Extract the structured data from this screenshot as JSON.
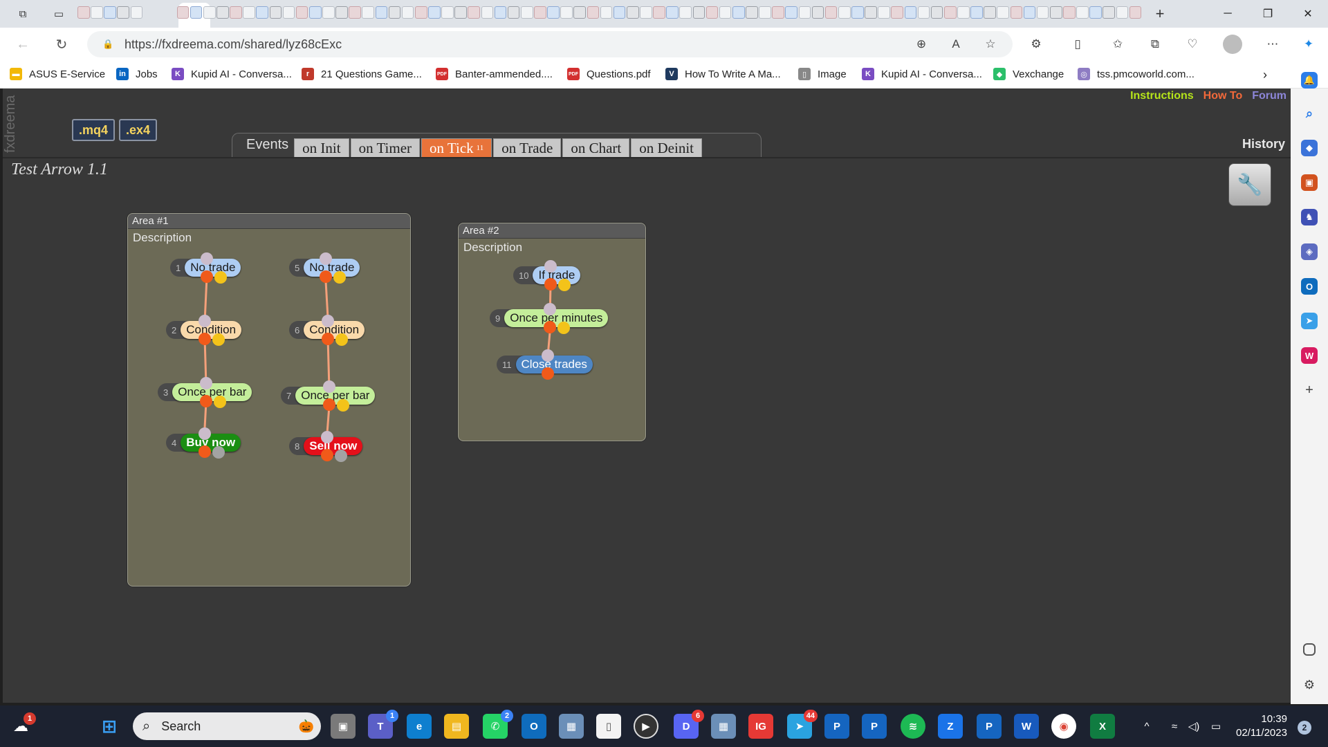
{
  "browser": {
    "url": "https://fxdreema.com/shared/lyz68cExc",
    "bookmarks": [
      {
        "label": "ASUS E-Service",
        "icon": "folder-icon",
        "color": "#f2b807"
      },
      {
        "label": "Jobs",
        "icon": "linkedin-icon",
        "color": "#0a66c2"
      },
      {
        "label": "Kupid AI - Conversa...",
        "icon": "kupid-icon",
        "color": "#7a4cc2"
      },
      {
        "label": "21 Questions Game...",
        "icon": "reddit-icon",
        "color": "#c0392b"
      },
      {
        "label": "Banter-ammended....",
        "icon": "pdf-icon",
        "color": "#d32f2f"
      },
      {
        "label": "Questions.pdf",
        "icon": "pdf-icon",
        "color": "#d32f2f"
      },
      {
        "label": "How To Write A Ma...",
        "icon": "v-icon",
        "color": "#1f3a5f"
      },
      {
        "label": "Image",
        "icon": "file-icon",
        "color": "#888888"
      },
      {
        "label": "Kupid AI - Conversa...",
        "icon": "kupid-icon",
        "color": "#7a4cc2"
      },
      {
        "label": "Vexchange",
        "icon": "vexchange-icon",
        "color": "#2bbf6a"
      },
      {
        "label": "tss.pmcoworld.com...",
        "icon": "globe-icon",
        "color": "#8e7cc3"
      }
    ]
  },
  "app": {
    "side_label": "fxdreema",
    "format_buttons": [
      ".mq4",
      ".ex4"
    ],
    "links": {
      "instructions": "Instructions",
      "howto": "How To",
      "forum": "Forum"
    },
    "history": "History",
    "events_label": "Events",
    "tabs": [
      {
        "label": "on Init"
      },
      {
        "label": "on Timer"
      },
      {
        "label": "on Tick",
        "count": "11",
        "active": true
      },
      {
        "label": "on Trade"
      },
      {
        "label": "on Chart"
      },
      {
        "label": "on Deinit"
      }
    ],
    "project_title": "Test Arrow 1.1",
    "areas": [
      {
        "title": "Area #1",
        "description": "Description"
      },
      {
        "title": "Area #2",
        "description": "Description"
      }
    ],
    "blocks": [
      {
        "id": "1",
        "label": "No trade"
      },
      {
        "id": "2",
        "label": "Condition"
      },
      {
        "id": "3",
        "label": "Once per bar"
      },
      {
        "id": "4",
        "label": "Buy now"
      },
      {
        "id": "5",
        "label": "No trade"
      },
      {
        "id": "6",
        "label": "Condition"
      },
      {
        "id": "7",
        "label": "Once per bar"
      },
      {
        "id": "8",
        "label": "Sell now"
      },
      {
        "id": "10",
        "label": "If trade"
      },
      {
        "id": "9",
        "label": "Once per minutes"
      },
      {
        "id": "11",
        "label": "Close trades"
      }
    ]
  },
  "taskbar": {
    "search_placeholder": "Search",
    "time": "10:39",
    "date": "02/11/2023",
    "weather_badge": "1",
    "teams_badge": "1",
    "whatsapp_badge": "2",
    "discord_badge": "6",
    "telegram_badge": "44",
    "notif_count": "2"
  }
}
